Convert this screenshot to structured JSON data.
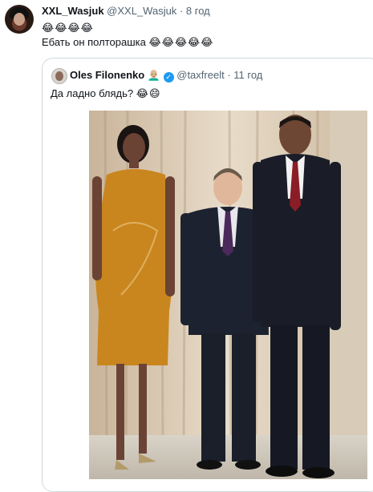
{
  "tweet": {
    "author_name": "XXL_Wasjuk",
    "author_handle": "@XXL_Wasjuk",
    "separator": "·",
    "time": "8 год",
    "line1": "😂😂😂😂",
    "line2_text": "Ебать он полторашка ",
    "line2_emoji": "😂😂😂😂😂"
  },
  "quote": {
    "author_name": "Oles Filonenko",
    "author_emoji": "👨🏼‍🦲",
    "verified_mark": "✓",
    "author_handle": "@taxfreelt",
    "separator": "·",
    "time": "11 год",
    "text": "Да ладно блядь? ",
    "text_emoji": "😂😄"
  },
  "colors": {
    "text_primary": "#0f1419",
    "text_secondary": "#536471",
    "border": "#cfd9de",
    "verified": "#1d9bf0"
  }
}
